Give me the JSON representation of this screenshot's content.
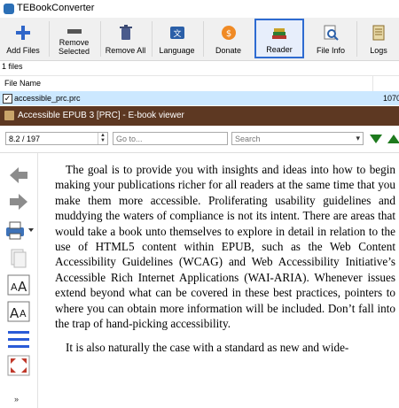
{
  "app": {
    "title": "TEBookConverter"
  },
  "toolbar": {
    "add_files": "Add Files",
    "remove_selected": "Remove\nSelected",
    "remove_all": "Remove All",
    "language": "Language",
    "donate": "Donate",
    "reader": "Reader",
    "file_info": "File Info",
    "logs": "Logs"
  },
  "files": {
    "count": "1 files",
    "header_name": "File Name",
    "rows": [
      {
        "name": "accessible_prc.prc",
        "size": "1070",
        "checked": "✓"
      }
    ]
  },
  "viewer": {
    "title": "Accessible EPUB 3 [PRC] - E-book viewer",
    "page_value": "8.2 / 197",
    "goto_placeholder": "Go to...",
    "search_placeholder": "Search",
    "paragraphs": [
      "The goal is to provide you with insights and ideas into how to begin making your publications richer for all readers at the same time that you make them more accessible. Proliferating usability guidelines and muddying the waters of compliance is not its intent. There are areas that would take a book unto themselves to explore in detail in relation to the use of HTML5 content within EPUB, such as the Web Content Accessibility Guidelines (WCAG) and Web Accessibility Initiative’s Accessible Rich Internet Applications (WAI-ARIA). Whenever issues extend beyond what can be covered in these best practices, pointers to where you can obtain more information will be included. Don’t fall into the trap of hand-picking accessibility.",
      "It is also naturally the case with a standard as new and wide-"
    ]
  },
  "colors": {
    "viewer_title_bg": "#5d3822",
    "selected_row": "#cce8ff",
    "accent": "#2e6bd1",
    "arrow_green": "#1e7a1e"
  }
}
